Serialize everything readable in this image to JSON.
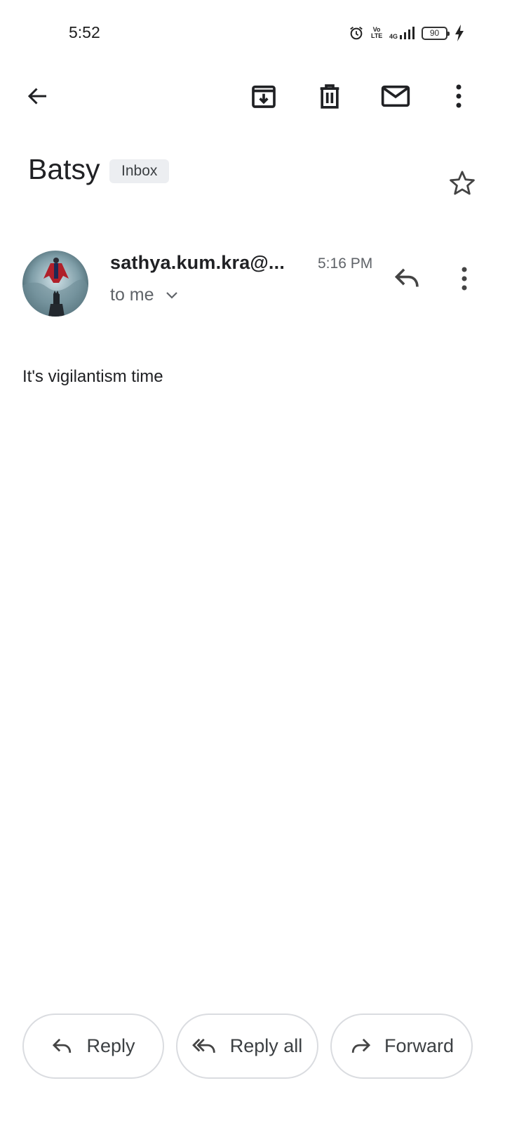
{
  "status_bar": {
    "time": "5:52",
    "network": "4G",
    "volte": "Vo LTE",
    "battery": "90"
  },
  "toolbar": {
    "icons": [
      "back-arrow-icon",
      "archive-icon",
      "delete-icon",
      "mark-unread-icon",
      "more-vert-icon"
    ]
  },
  "email": {
    "subject": "Batsy",
    "label": "Inbox",
    "sender": "sathya.kum.kra@...",
    "time": "5:16 PM",
    "recipient": "to me",
    "body": "It's vigilantism time"
  },
  "actions": {
    "reply": "Reply",
    "reply_all": "Reply all",
    "forward": "Forward"
  },
  "colors": {
    "icon": "#202124",
    "secondary_text": "#5f6368",
    "chip_bg": "#eceef1",
    "button_border": "#dadce0"
  }
}
